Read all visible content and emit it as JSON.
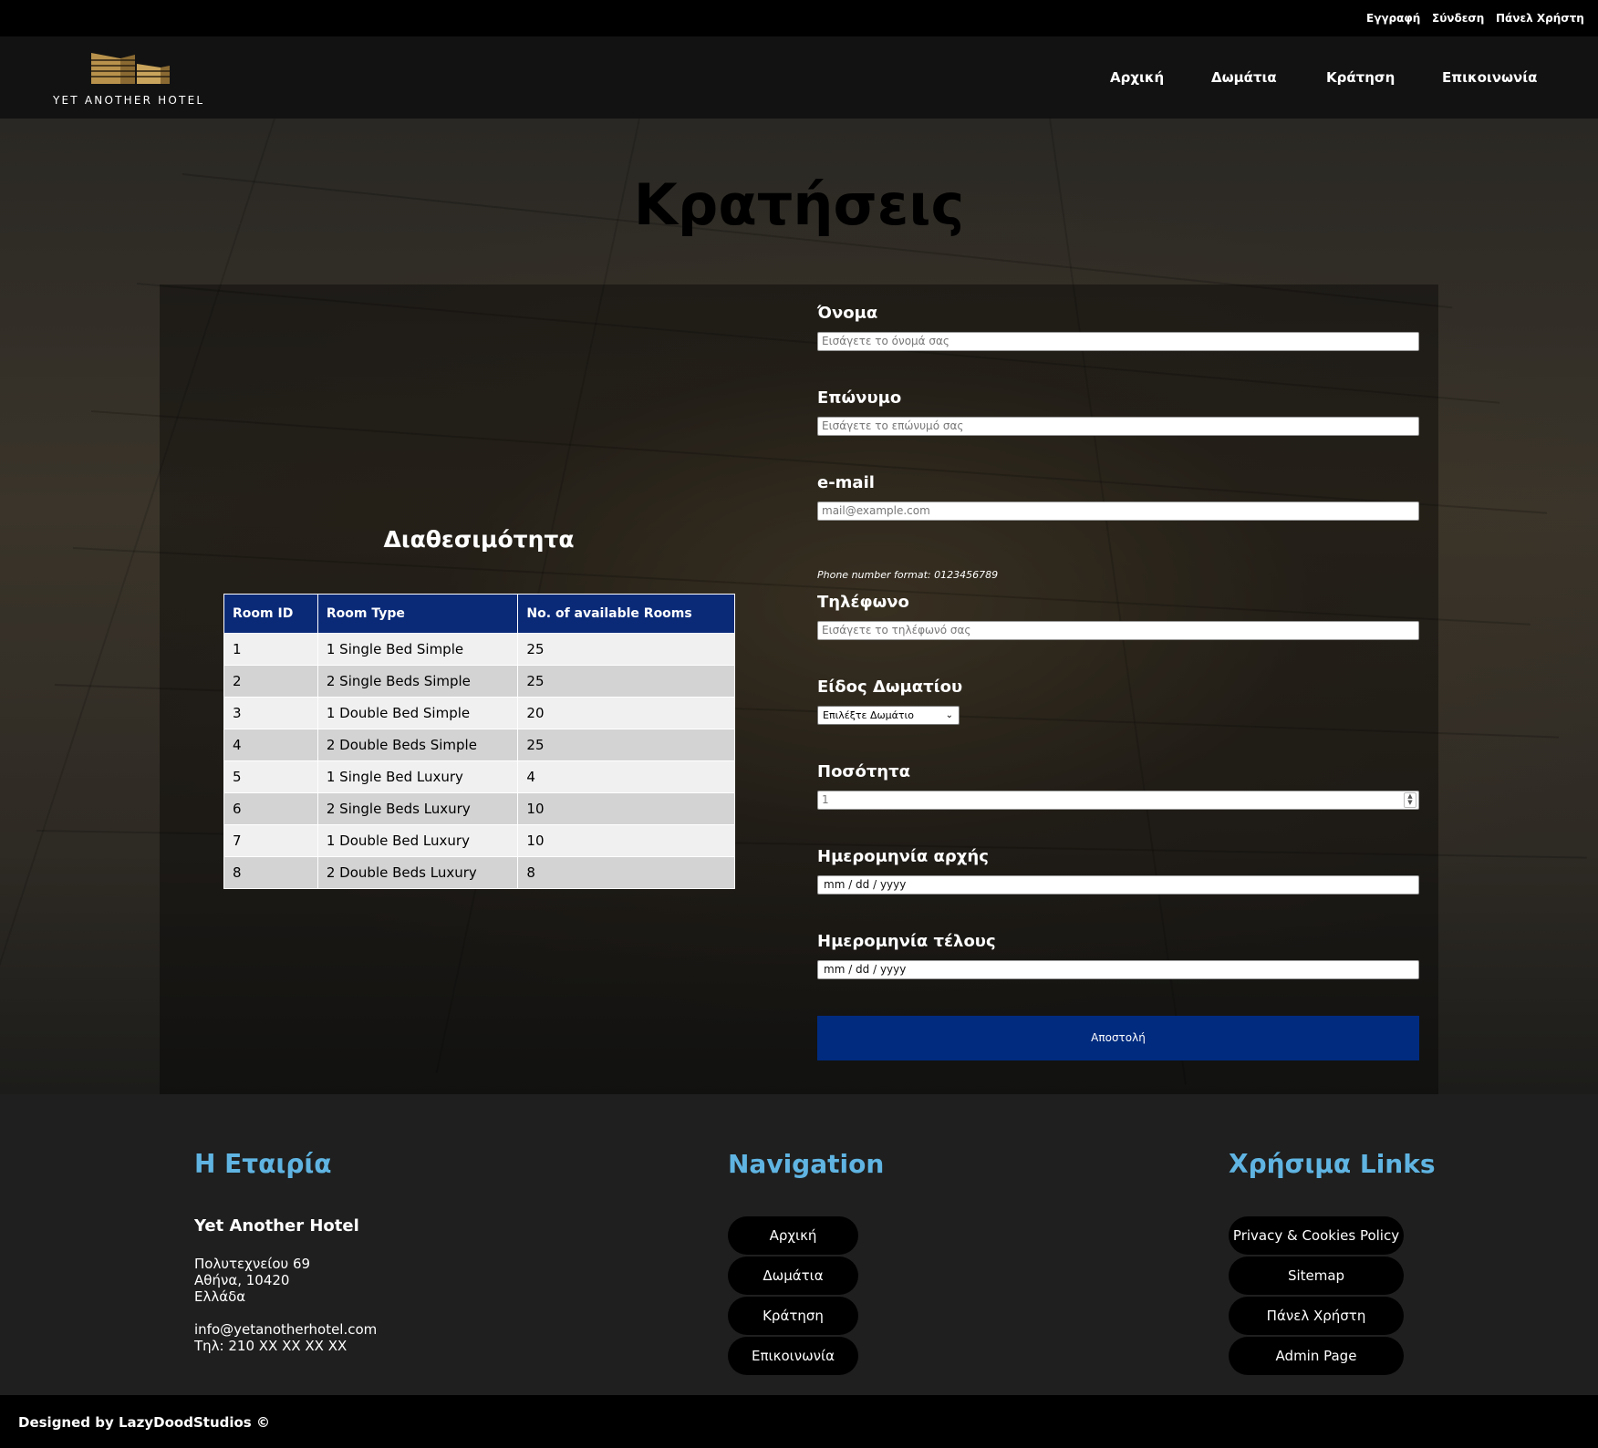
{
  "topbar": {
    "register": "Εγγραφή",
    "login": "Σύνδεση",
    "user_panel": "Πάνελ Χρήστη"
  },
  "header": {
    "logo_text": "YET ANOTHER HOTEL",
    "nav": {
      "home": "Αρχική",
      "rooms": "Δωμάτια",
      "booking": "Κράτηση",
      "contact": "Επικοινωνία"
    }
  },
  "page_title": "Κρατήσεις",
  "availability": {
    "title": "Διαθεσιμότητα",
    "columns": [
      "Room ID",
      "Room Type",
      "No. of available Rooms"
    ],
    "rows": [
      [
        "1",
        "1 Single Bed Simple",
        "25"
      ],
      [
        "2",
        "2 Single Beds Simple",
        "25"
      ],
      [
        "3",
        "1 Double Bed Simple",
        "20"
      ],
      [
        "4",
        "2 Double Beds Simple",
        "25"
      ],
      [
        "5",
        "1 Single Bed Luxury",
        "4"
      ],
      [
        "6",
        "2 Single Beds Luxury",
        "10"
      ],
      [
        "7",
        "1 Double Bed Luxury",
        "10"
      ],
      [
        "8",
        "2 Double Beds Luxury",
        "8"
      ]
    ]
  },
  "form": {
    "name_label": "Όνομα",
    "name_placeholder": "Εισάγετε το όνομά σας",
    "surname_label": "Επώνυμο",
    "surname_placeholder": "Εισάγετε το επώνυμό σας",
    "email_label": "e-mail",
    "email_placeholder": "mail@example.com",
    "phone_hint": "Phone number format: 0123456789",
    "phone_label": "Τηλέφωνο",
    "phone_placeholder": "Εισάγετε το τηλέφωνό σας",
    "room_type_label": "Είδος Δωματίου",
    "room_type_selected": "Επιλέξτε Δωμάτιο",
    "quantity_label": "Ποσότητα",
    "quantity_value": "1",
    "start_date_label": "Ημερομηνία αρχής",
    "start_date_value": "mm / dd / yyyy",
    "end_date_label": "Ημερομηνία τέλους",
    "end_date_value": "mm / dd / yyyy",
    "submit_label": "Αποστολή"
  },
  "footer": {
    "company_title": "Η Εταιρία",
    "hotel_name": "Yet Another Hotel",
    "address_line1": "Πολυτεχνείου 69",
    "address_line2": "Αθήνα, 10420",
    "address_line3": "Ελλάδα",
    "email": "info@yetanotherhotel.com",
    "phone": "Τηλ: 210 XX XX XX XX",
    "nav_title": "Navigation",
    "nav_links": [
      "Αρχική",
      "Δωμάτια",
      "Κράτηση",
      "Επικοινωνία"
    ],
    "links_title": "Χρήσιμα Links",
    "useful_links": [
      "Privacy & Cookies Policy",
      "Sitemap",
      "Πάνελ Χρήστη",
      "Admin Page"
    ],
    "credit": "Designed by LazyDoodStudios ©"
  },
  "colors": {
    "accent_blue": "#002b7f",
    "table_header": "#0a2a78",
    "footer_heading": "#5fb4e2",
    "logo_gold": "#c9a45c"
  }
}
